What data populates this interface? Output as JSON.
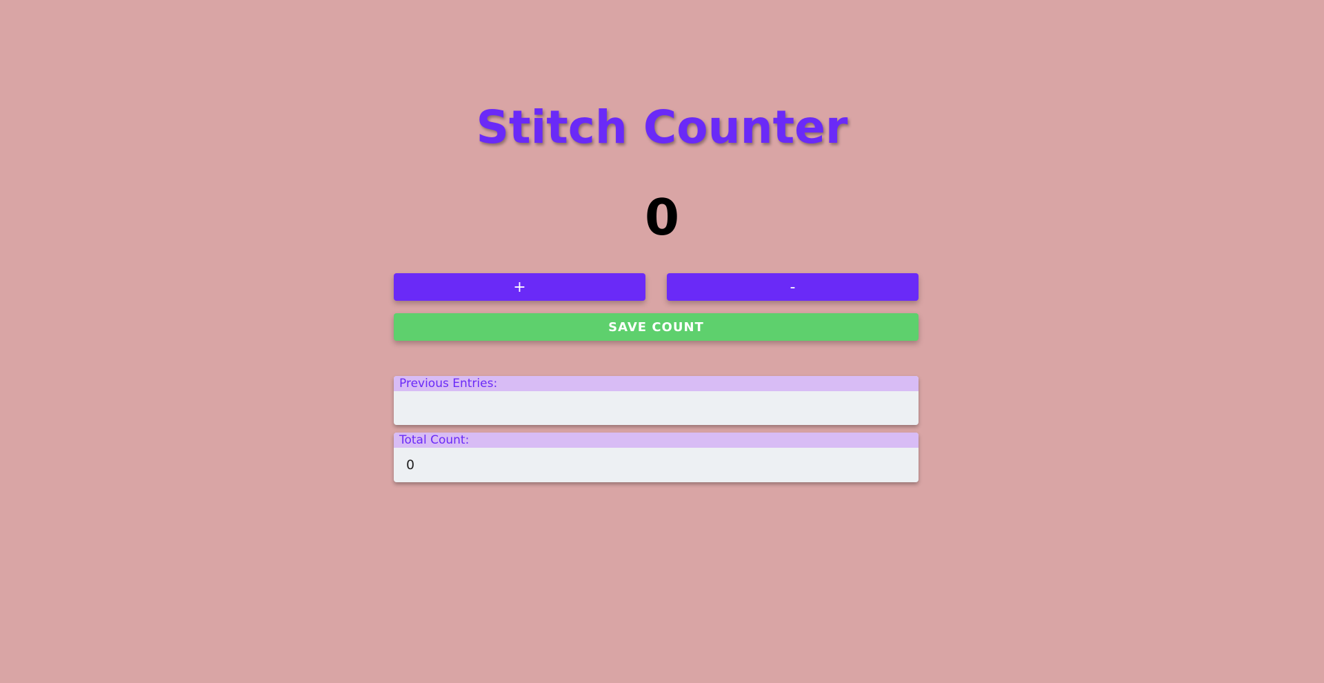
{
  "app": {
    "title": "Stitch Counter"
  },
  "counter": {
    "value": "0"
  },
  "buttons": {
    "increment_label": "+",
    "decrement_label": "-",
    "save_label": "SAVE COUNT"
  },
  "previous_entries": {
    "label": "Previous Entries:",
    "entries": []
  },
  "total": {
    "label": "Total Count:",
    "value": "0"
  },
  "colors": {
    "background": "#d9a5a5",
    "accent": "#6a2af7",
    "save": "#5ed06d",
    "panel_header": "#d8bcf5",
    "panel_body": "#edf0f3"
  }
}
